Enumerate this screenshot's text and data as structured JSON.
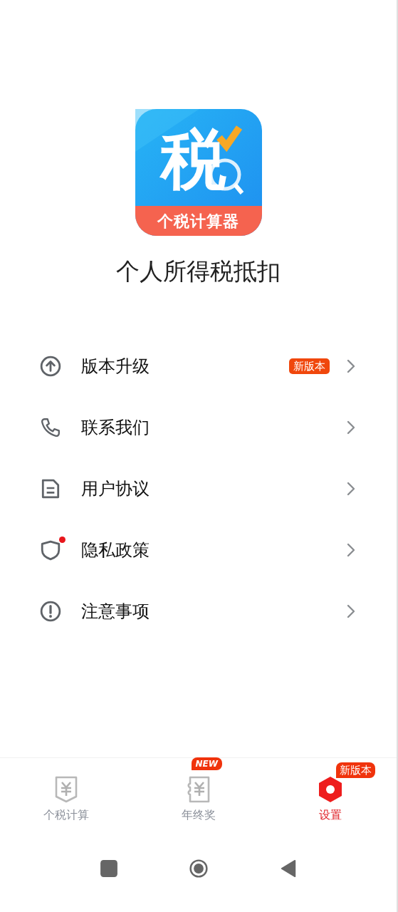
{
  "app_icon": {
    "glyph": "税",
    "caption": "个税计算器"
  },
  "app_name": "个人所得税抵扣",
  "menu": [
    {
      "kind": "upgrade",
      "label": "版本升级",
      "badge": "新版本",
      "dot": false
    },
    {
      "kind": "phone",
      "label": "联系我们",
      "dot": false
    },
    {
      "kind": "document",
      "label": "用户协议",
      "dot": false
    },
    {
      "kind": "shield",
      "label": "隐私政策",
      "dot": true
    },
    {
      "kind": "alert",
      "label": "注意事项",
      "dot": false
    }
  ],
  "tabs": [
    {
      "kind": "tax",
      "label": "个税计算",
      "selected": false
    },
    {
      "kind": "bonus",
      "label": "年终奖",
      "selected": false,
      "badge": "NEW"
    },
    {
      "kind": "settings",
      "label": "设置",
      "selected": true,
      "badge": "新版本"
    }
  ],
  "system_nav": [
    {
      "kind": "recents"
    },
    {
      "kind": "home"
    },
    {
      "kind": "back"
    }
  ]
}
